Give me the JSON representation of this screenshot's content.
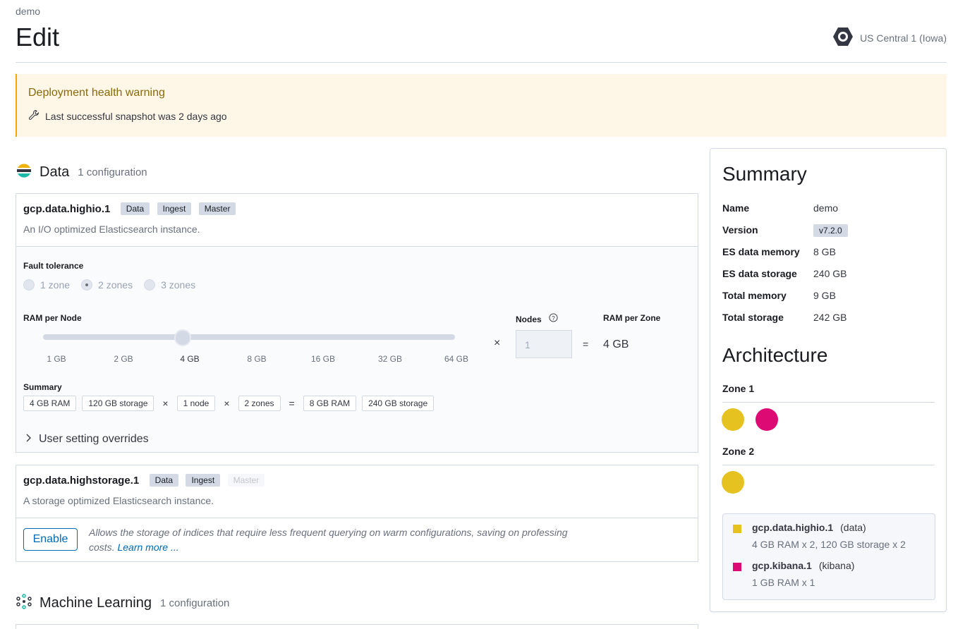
{
  "breadcrumb": "demo",
  "page_title": "Edit",
  "region": {
    "label": "US Central 1 (Iowa)"
  },
  "callout": {
    "title": "Deployment health warning",
    "message": "Last successful snapshot was 2 days ago"
  },
  "data_section": {
    "title": "Data",
    "subtitle": "1 configuration",
    "instances": [
      {
        "name": "gcp.data.highio.1",
        "badges": [
          "Data",
          "Ingest",
          "Master"
        ],
        "description": "An I/O optimized Elasticsearch instance.",
        "fault_tolerance": {
          "label": "Fault tolerance",
          "options": [
            "1 zone",
            "2 zones",
            "3 zones"
          ],
          "selected": "2 zones"
        },
        "ram_per_node": {
          "label": "RAM per Node",
          "ticks": [
            "1 GB",
            "2 GB",
            "4 GB",
            "8 GB",
            "16 GB",
            "32 GB",
            "64 GB"
          ],
          "selected": "4 GB"
        },
        "nodes": {
          "label": "Nodes",
          "value": "1"
        },
        "multiply": "×",
        "equals": "=",
        "ram_per_zone": {
          "label": "RAM per Zone",
          "value": "4 GB"
        },
        "summary": {
          "label": "Summary",
          "ram": "4 GB RAM",
          "storage": "120 GB storage",
          "nodes": "1 node",
          "zones": "2 zones",
          "total_ram": "8 GB RAM",
          "total_storage": "240 GB storage"
        },
        "overrides_label": "User setting overrides"
      },
      {
        "name": "gcp.data.highstorage.1",
        "badges": [
          "Data",
          "Ingest",
          "Master"
        ],
        "disabled_badge": "Master",
        "description": "A storage optimized Elasticsearch instance.",
        "enable_label": "Enable",
        "enable_text": "Allows the storage of indices that require less frequent querying on warm configurations, saving on professing costs.",
        "learn_more": "Learn more ..."
      }
    ]
  },
  "ml_section": {
    "title": "Machine Learning",
    "subtitle": "1 configuration"
  },
  "summary_card": {
    "title": "Summary",
    "rows": [
      {
        "key": "Name",
        "value": "demo"
      },
      {
        "key": "Version",
        "value": "v7.2.0"
      },
      {
        "key": "ES data memory",
        "value": "8 GB"
      },
      {
        "key": "ES data storage",
        "value": "240 GB"
      },
      {
        "key": "Total memory",
        "value": "9 GB"
      },
      {
        "key": "Total storage",
        "value": "242 GB"
      }
    ],
    "architecture_title": "Architecture",
    "zones": [
      {
        "label": "Zone 1",
        "nodes": [
          "data",
          "kibana"
        ]
      },
      {
        "label": "Zone 2",
        "nodes": [
          "data"
        ]
      }
    ],
    "legend": [
      {
        "name": "gcp.data.highio.1",
        "type": "(data)",
        "detail": "4 GB RAM x 2, 120 GB storage x 2",
        "color": "#e6c220"
      },
      {
        "name": "gcp.kibana.1",
        "type": "(kibana)",
        "detail": "1 GB RAM x 1",
        "color": "#dd0a73"
      }
    ]
  },
  "colors": {
    "data_node": "#e6c220",
    "kibana_node": "#dd0a73",
    "link": "#006bb4",
    "warning_border": "#f5a700"
  }
}
